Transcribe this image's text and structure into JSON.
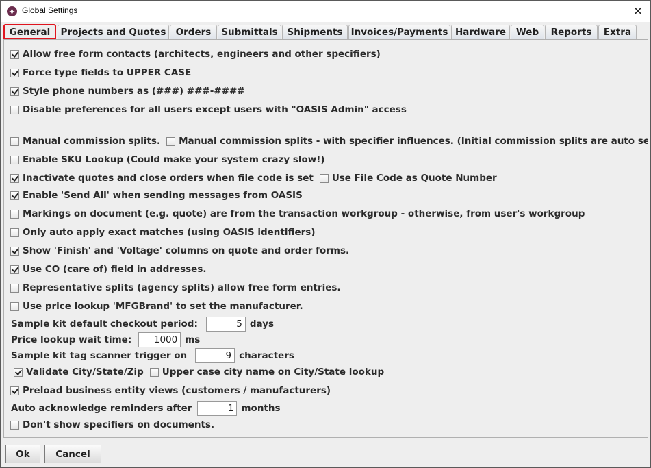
{
  "window": {
    "title": "Global Settings"
  },
  "tabs": [
    "General",
    "Projects and Quotes",
    "Orders",
    "Submittals",
    "Shipments",
    "Invoices/Payments",
    "Hardware",
    "Web",
    "Reports",
    "Extra"
  ],
  "active_tab": "General",
  "options": {
    "free_form_contacts": {
      "label": "Allow free form contacts (architects, engineers and other specifiers)",
      "checked": true
    },
    "upper_case_types": {
      "label": "Force type fields to UPPER CASE",
      "checked": true
    },
    "style_phone": {
      "label": "Style phone numbers as (###) ###-####",
      "checked": true
    },
    "disable_prefs": {
      "label": "Disable preferences for all users except users with \"OASIS Admin\" access",
      "checked": false
    },
    "manual_commission": {
      "label": "Manual commission splits.",
      "checked": false
    },
    "manual_commission_specifier": {
      "label": "Manual commission splits - with specifier influences. (Initial commission splits are auto selected.  Ma",
      "checked": false
    },
    "sku_lookup": {
      "label": "Enable SKU Lookup (Could make your system crazy slow!)",
      "checked": false
    },
    "inactivate_quotes": {
      "label": "Inactivate quotes and close orders when file code is set",
      "checked": true
    },
    "file_code_quote_number": {
      "label": "Use File Code as Quote Number",
      "checked": false
    },
    "send_all": {
      "label": "Enable 'Send All' when sending messages from OASIS",
      "checked": true
    },
    "markings_workgroup": {
      "label": "Markings on document (e.g. quote) are from the transaction workgroup - otherwise, from user's workgroup",
      "checked": false
    },
    "exact_matches": {
      "label": "Only auto apply exact matches (using OASIS identifiers)",
      "checked": false
    },
    "finish_voltage": {
      "label": "Show 'Finish' and 'Voltage' columns on quote and order forms.",
      "checked": true
    },
    "care_of": {
      "label": "Use CO (care of) field in addresses.",
      "checked": true
    },
    "rep_splits": {
      "label": "Representative splits (agency splits) allow free form entries.",
      "checked": false
    },
    "mfg_brand": {
      "label": "Use price lookup 'MFGBrand' to set the manufacturer.",
      "checked": false
    },
    "validate_city": {
      "label": "Validate City/State/Zip",
      "checked": true
    },
    "upper_city": {
      "label": "Upper case city name on City/State lookup",
      "checked": false
    },
    "preload_views": {
      "label": "Preload business entity views (customers / manufacturers)",
      "checked": true
    },
    "no_specifiers": {
      "label": "Don't show specifiers on documents.",
      "checked": false
    }
  },
  "fields": {
    "sample_kit_checkout": {
      "label": "Sample kit default checkout period:",
      "value": "5",
      "unit": "days"
    },
    "price_lookup_wait": {
      "label": "Price lookup wait time:",
      "value": "1000",
      "unit": "ms"
    },
    "scanner_trigger": {
      "label": "Sample kit tag scanner trigger on",
      "value": "9",
      "unit": "characters"
    },
    "auto_ack": {
      "label": "Auto acknowledge reminders after",
      "value": "1",
      "unit": "months"
    }
  },
  "buttons": {
    "ok": "Ok",
    "cancel": "Cancel"
  }
}
